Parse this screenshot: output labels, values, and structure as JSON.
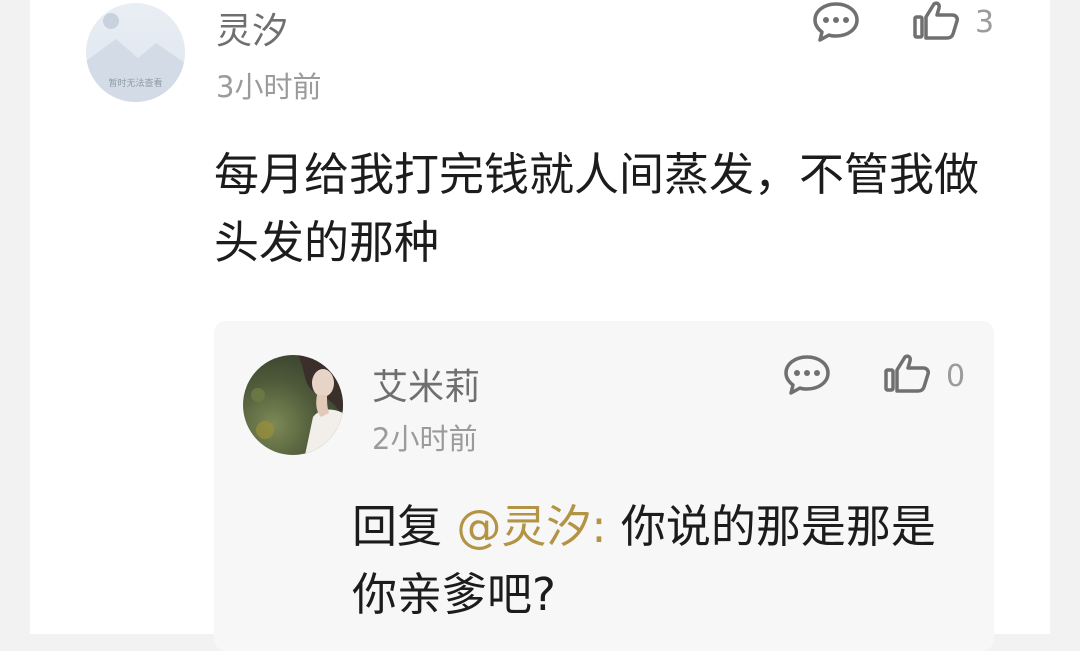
{
  "comment": {
    "avatar_caption": "暂时无法查看",
    "author": "灵汐",
    "time": "3小时前",
    "text": "每月给我打完钱就人间蒸发，不管我做头发的那种",
    "like_count": "3"
  },
  "reply": {
    "author": "艾米莉",
    "time": "2小时前",
    "prefix": "回复",
    "mention": "@灵汐:",
    "text": "你说的那是那是你亲爹吧?",
    "like_count": "0"
  },
  "icons": {
    "comment": "comment-bubble-icon",
    "like": "thumbs-up-icon"
  },
  "colors": {
    "mention": "#b39445",
    "text": "#1c1c1c",
    "meta": "#9b9b9b"
  }
}
